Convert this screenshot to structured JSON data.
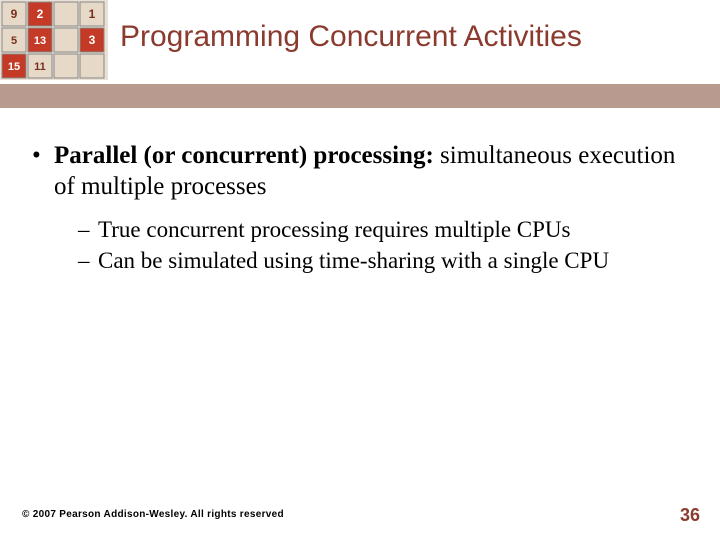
{
  "slide": {
    "title": "Programming Concurrent Activities",
    "bullet_bold": "Parallel (or concurrent) processing:",
    "bullet_rest": " simultaneous execution of multiple processes",
    "sub": [
      "True concurrent processing requires multiple CPUs",
      "Can be simulated using time-sharing with a single CPU"
    ]
  },
  "footer": {
    "copyright": "© 2007 Pearson Addison-Wesley. All rights reserved",
    "page_number": "36"
  }
}
